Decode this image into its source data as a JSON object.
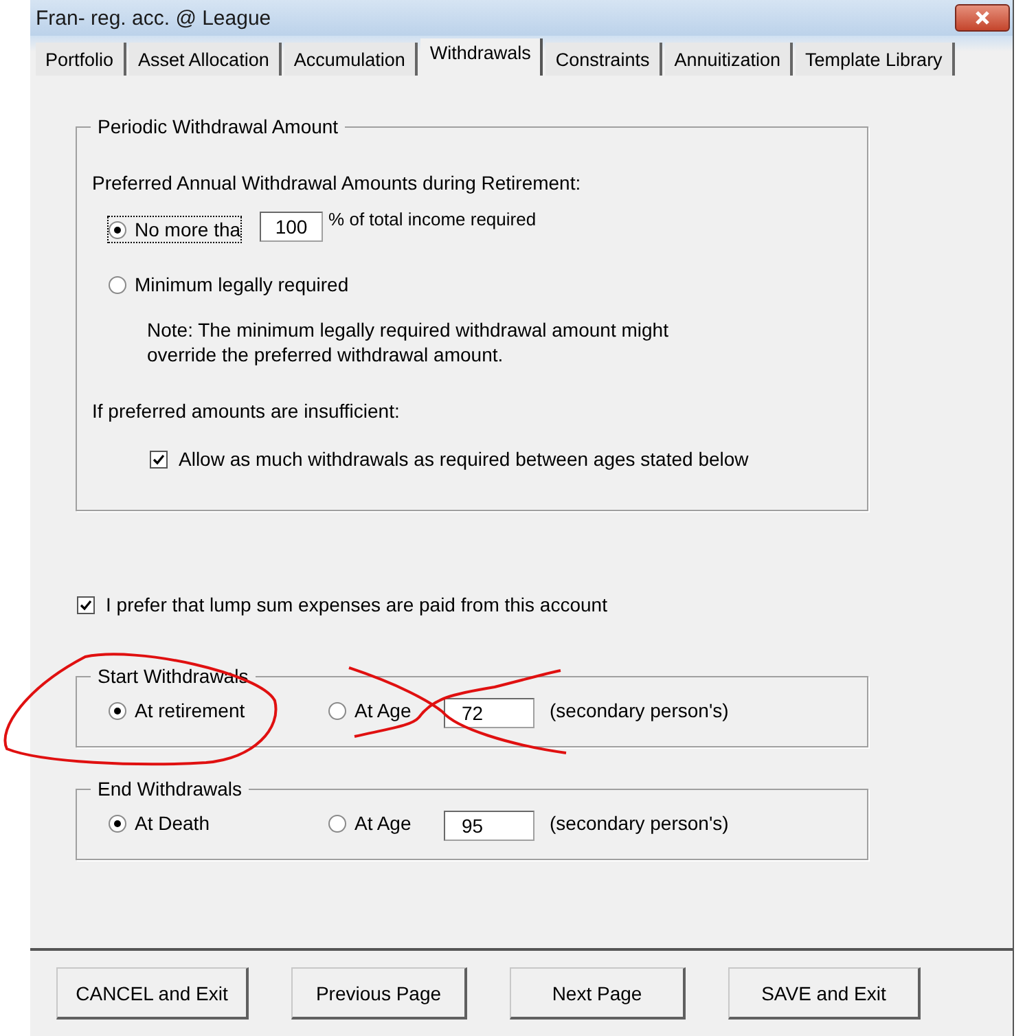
{
  "window": {
    "title": "Fran- reg. acc. @ League"
  },
  "tabs": [
    {
      "label": "Portfolio",
      "selected": false
    },
    {
      "label": "Asset Allocation",
      "selected": false
    },
    {
      "label": "Accumulation",
      "selected": false
    },
    {
      "label": "Withdrawals",
      "selected": true
    },
    {
      "label": "Constraints",
      "selected": false
    },
    {
      "label": "Annuitization",
      "selected": false
    },
    {
      "label": "Template Library",
      "selected": false
    }
  ],
  "periodic": {
    "title": "Periodic Withdrawal Amount",
    "heading": "Preferred Annual Withdrawal Amounts during Retirement:",
    "options": [
      {
        "kind": "with_field",
        "label": "No more tha",
        "selected": true,
        "focused": true,
        "value": "100",
        "suffix": "% of total income required"
      },
      {
        "kind": "plain",
        "label": "Minimum legally required",
        "selected": false,
        "focused": false
      }
    ],
    "note": [
      "Note: The minimum legally required withdrawal amount might",
      "override the preferred withdrawal amount."
    ],
    "insufficient": "If preferred amounts are insufficient:",
    "allow": {
      "label": "Allow as much withdrawals as required between ages stated below",
      "checked": true
    }
  },
  "lump_sum": {
    "label": "I prefer that lump sum expenses are paid from this account",
    "checked": true
  },
  "age_groups": [
    {
      "title": "Start Withdrawals",
      "options": [
        {
          "label": "At retirement",
          "selected": true
        },
        {
          "label": "At Age",
          "selected": false
        }
      ],
      "age": "72",
      "note": "(secondary person's)"
    },
    {
      "title": "End Withdrawals",
      "options": [
        {
          "label": "At Death",
          "selected": true
        },
        {
          "label": "At Age",
          "selected": false
        }
      ],
      "age": "95",
      "note": "(secondary person's)"
    }
  ],
  "buttons": [
    "CANCEL and Exit",
    "Previous Page",
    "Next Page",
    "SAVE and Exit"
  ]
}
